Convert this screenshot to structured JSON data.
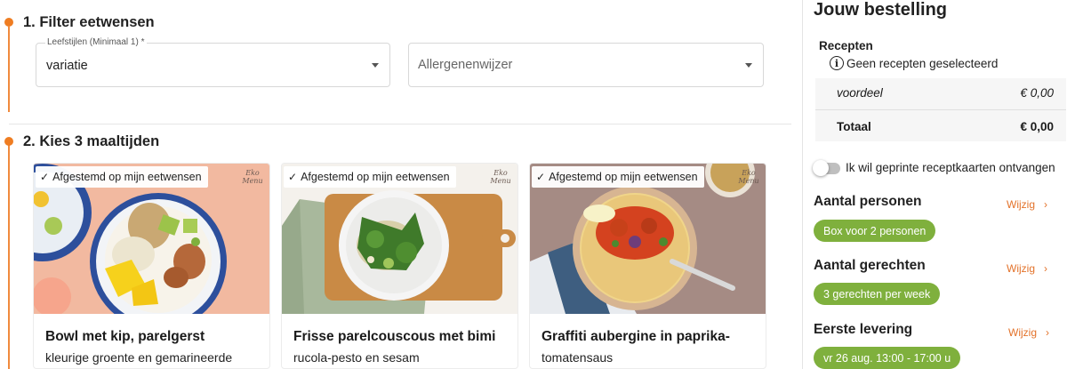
{
  "filter": {
    "step_title": "1. Filter eetwensen",
    "lifestyle": {
      "label": "Leefstijlen (Minimaal 1) *",
      "value": "variatie"
    },
    "allergen": {
      "placeholder": "Allergenenwijzer"
    }
  },
  "meals": {
    "step_title": "2. Kies 3 maaltijden",
    "cards": [
      {
        "badge": "Afgestemd op mijn eetwensen",
        "brand": "Eko Menu",
        "title": "Bowl met kip, parelgerst",
        "subtitle": "kleurige groente en gemarineerde"
      },
      {
        "badge": "Afgestemd op mijn eetwensen",
        "brand": "Eko Menu",
        "title": "Frisse parelcouscous met bimi",
        "subtitle": "rucola-pesto en sesam"
      },
      {
        "badge": "Afgestemd op mijn eetwensen",
        "brand": "Eko Menu",
        "title": "Graffiti aubergine in paprika-",
        "subtitle": "tomatensaus"
      }
    ]
  },
  "order": {
    "title": "Jouw bestelling",
    "recipes_label": "Recepten",
    "no_recipes": "Geen recepten geselecteerd",
    "discount_label": "voordeel",
    "discount_value": "€ 0,00",
    "total_label": "Totaal",
    "total_value": "€ 0,00",
    "printed_cards_label": "Ik wil geprinte receptkaarten ontvangen",
    "printed_cards_on": false,
    "persons": {
      "title": "Aantal personen",
      "change": "Wijzig",
      "value": "Box voor 2 personen"
    },
    "dishes": {
      "title": "Aantal gerechten",
      "change": "Wijzig",
      "value": "3 gerechten per week"
    },
    "delivery": {
      "title": "Eerste levering",
      "change": "Wijzig",
      "value": "vr 26 aug. 13:00 - 17:00 u"
    }
  },
  "colors": {
    "accent": "#ef7d22",
    "pill_green": "#7fb03d"
  }
}
